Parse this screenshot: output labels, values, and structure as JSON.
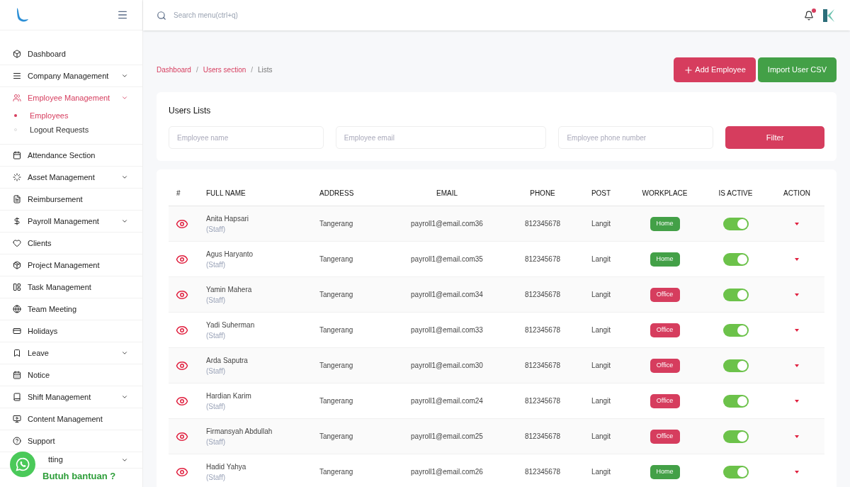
{
  "search": {
    "placeholder": "Search menu(ctrl+q)"
  },
  "sidebar": {
    "items": [
      {
        "label": "Dashboard",
        "selected": false,
        "expandable": false
      },
      {
        "label": "Company Management",
        "selected": false,
        "expandable": true
      },
      {
        "label": "Employee Management",
        "selected": true,
        "expandable": true,
        "children": [
          {
            "label": "Employees",
            "selected": true
          },
          {
            "label": "Logout Requests",
            "selected": false
          }
        ]
      },
      {
        "label": "Attendance Section",
        "selected": false,
        "expandable": false
      },
      {
        "label": "Asset Management",
        "selected": false,
        "expandable": true
      },
      {
        "label": "Reimbursement",
        "selected": false,
        "expandable": false
      },
      {
        "label": "Payroll Management",
        "selected": false,
        "expandable": true
      },
      {
        "label": "Clients",
        "selected": false,
        "expandable": false
      },
      {
        "label": "Project Management",
        "selected": false,
        "expandable": false
      },
      {
        "label": "Task Management",
        "selected": false,
        "expandable": false
      },
      {
        "label": "Team Meeting",
        "selected": false,
        "expandable": false
      },
      {
        "label": "Holidays",
        "selected": false,
        "expandable": false
      },
      {
        "label": "Leave",
        "selected": false,
        "expandable": true
      },
      {
        "label": "Notice",
        "selected": false,
        "expandable": false
      },
      {
        "label": "Shift Management",
        "selected": false,
        "expandable": true
      },
      {
        "label": "Content Management",
        "selected": false,
        "expandable": false
      },
      {
        "label": "Support",
        "selected": false,
        "expandable": false
      },
      {
        "label": "tting",
        "selected": false,
        "expandable": true
      }
    ]
  },
  "help_button": {
    "label": "Butuh bantuan ?"
  },
  "breadcrumb": [
    {
      "label": "Dashboard",
      "kind": "link"
    },
    {
      "label": "/",
      "kind": "separator"
    },
    {
      "label": "Users section",
      "kind": "link"
    },
    {
      "label": "/",
      "kind": "separator"
    },
    {
      "label": "Lists",
      "kind": "current"
    }
  ],
  "actions": [
    {
      "label": "Add Employee",
      "color": "#d63d5e"
    },
    {
      "label": "Import User CSV",
      "color": "#43a047"
    }
  ],
  "filter_card": {
    "title": "Users Lists",
    "fields": [
      {
        "placeholder": "Employee name"
      },
      {
        "placeholder": "Employee email"
      },
      {
        "placeholder": "Employee phone number"
      }
    ],
    "button": "Filter"
  },
  "table": {
    "columns": [
      "#",
      "FULL NAME",
      "ADDRESS",
      "EMAIL",
      "PHONE",
      "POST",
      "WORKPLACE",
      "IS ACTIVE",
      "ACTION"
    ],
    "rows": [
      {
        "name": "Anita Hapsari",
        "role": "(Staff)",
        "address": "Tangerang",
        "email": "payroll1@email.com36",
        "phone": "812345678",
        "post": "Langit",
        "workplace": "Home",
        "color": "#43a047",
        "active": true
      },
      {
        "name": "Agus Haryanto",
        "role": "(Staff)",
        "address": "Tangerang",
        "email": "payroll1@email.com35",
        "phone": "812345678",
        "post": "Langit",
        "workplace": "Home",
        "color": "#43a047",
        "active": true
      },
      {
        "name": "Yamin Mahera",
        "role": "(Staff)",
        "address": "Tangerang",
        "email": "payroll1@email.com34",
        "phone": "812345678",
        "post": "Langit",
        "workplace": "Office",
        "color": "#d63d5e",
        "active": true
      },
      {
        "name": "Yadi Suherman",
        "role": "(Staff)",
        "address": "Tangerang",
        "email": "payroll1@email.com33",
        "phone": "812345678",
        "post": "Langit",
        "workplace": "Office",
        "color": "#d63d5e",
        "active": true
      },
      {
        "name": "Arda Saputra",
        "role": "(Staff)",
        "address": "Tangerang",
        "email": "payroll1@email.com30",
        "phone": "812345678",
        "post": "Langit",
        "workplace": "Office",
        "color": "#d63d5e",
        "active": true
      },
      {
        "name": "Hardian Karim",
        "role": "(Staff)",
        "address": "Tangerang",
        "email": "payroll1@email.com24",
        "phone": "812345678",
        "post": "Langit",
        "workplace": "Office",
        "color": "#d63d5e",
        "active": true
      },
      {
        "name": "Firmansyah Abdullah",
        "role": "(Staff)",
        "address": "Tangerang",
        "email": "payroll1@email.com25",
        "phone": "812345678",
        "post": "Langit",
        "workplace": "Office",
        "color": "#d63d5e",
        "active": true
      },
      {
        "name": "Hadid Yahya",
        "role": "(Staff)",
        "address": "Tangerang",
        "email": "payroll1@email.com26",
        "phone": "812345678",
        "post": "Langit",
        "workplace": "Home",
        "color": "#43a047",
        "active": true
      }
    ]
  }
}
